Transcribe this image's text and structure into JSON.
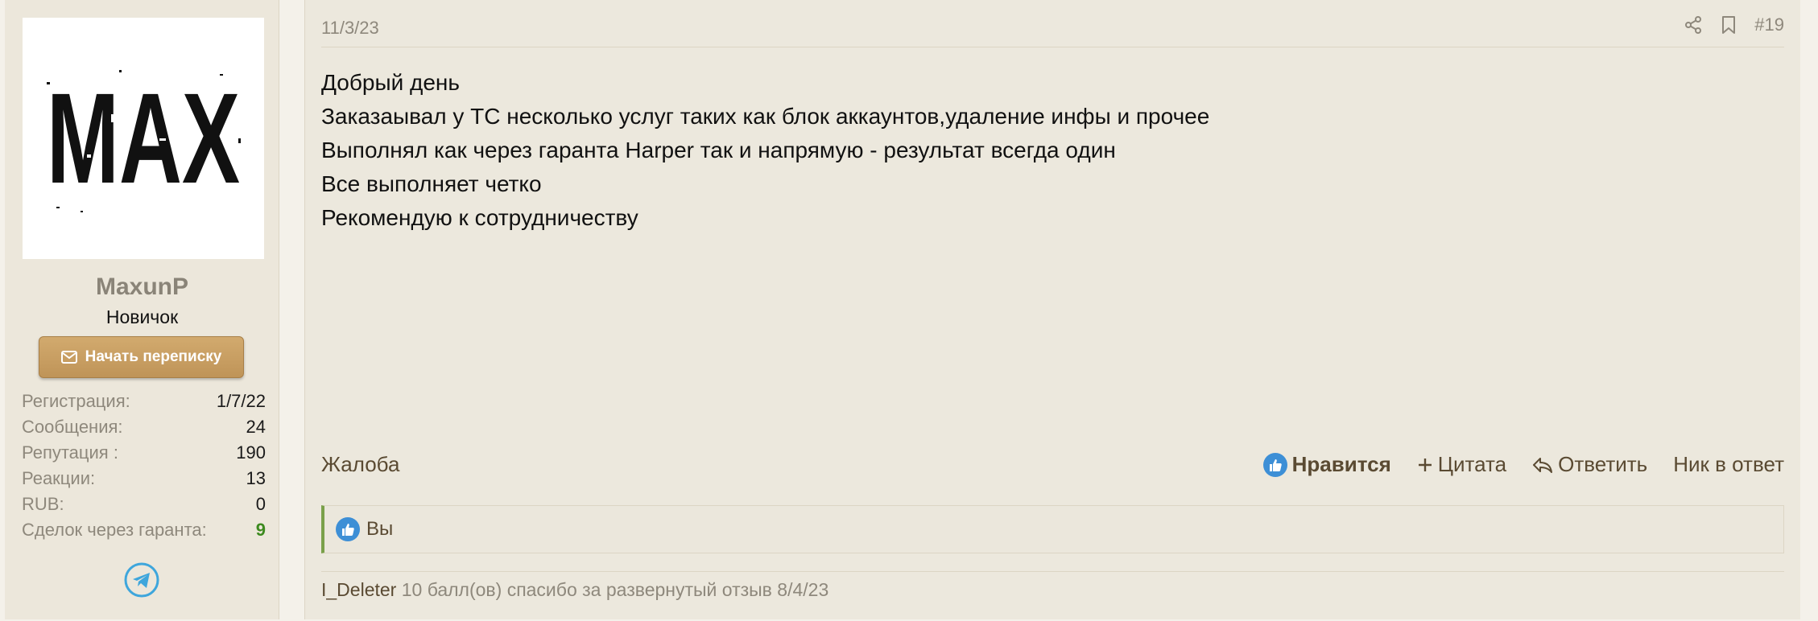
{
  "user": {
    "avatar_text": "MAX",
    "username": "MaxunP",
    "title": "Новичок",
    "message_button": "Начать переписку",
    "stats": [
      {
        "label": "Регистрация:",
        "value": "1/7/22"
      },
      {
        "label": "Сообщения:",
        "value": "24"
      },
      {
        "label": "Репутация :",
        "value": "190"
      },
      {
        "label": "Реакции:",
        "value": "13"
      },
      {
        "label": "RUB:",
        "value": "0"
      },
      {
        "label": "Сделок через гаранта:",
        "value": "9"
      }
    ]
  },
  "post": {
    "date": "11/3/23",
    "number": "#19",
    "lines": [
      "Добрый день",
      "Заказаывал у ТС несколько услуг таких как блок аккаунтов,удаление инфы и прочее",
      "Выполнял как через гаранта Harper так и напрямую - результат всегда один",
      "Все выполняет четко",
      "Рекомендую к сотрудничеству"
    ],
    "report": "Жалоба",
    "actions": {
      "like": "Нравится",
      "quote": "Цитата",
      "reply": "Ответить",
      "nick": "Ник в ответ"
    },
    "likes_text": "Вы",
    "reputation": {
      "user": "I_Deleter",
      "text": "10 балл(ов) спасибо за развернутый отзыв 8/4/23"
    }
  },
  "colors": {
    "accent_button": "#c79e62",
    "deals_green": "#3d8a1f",
    "like_blue": "#3d8fd6",
    "telegram": "#3ea6dc"
  }
}
